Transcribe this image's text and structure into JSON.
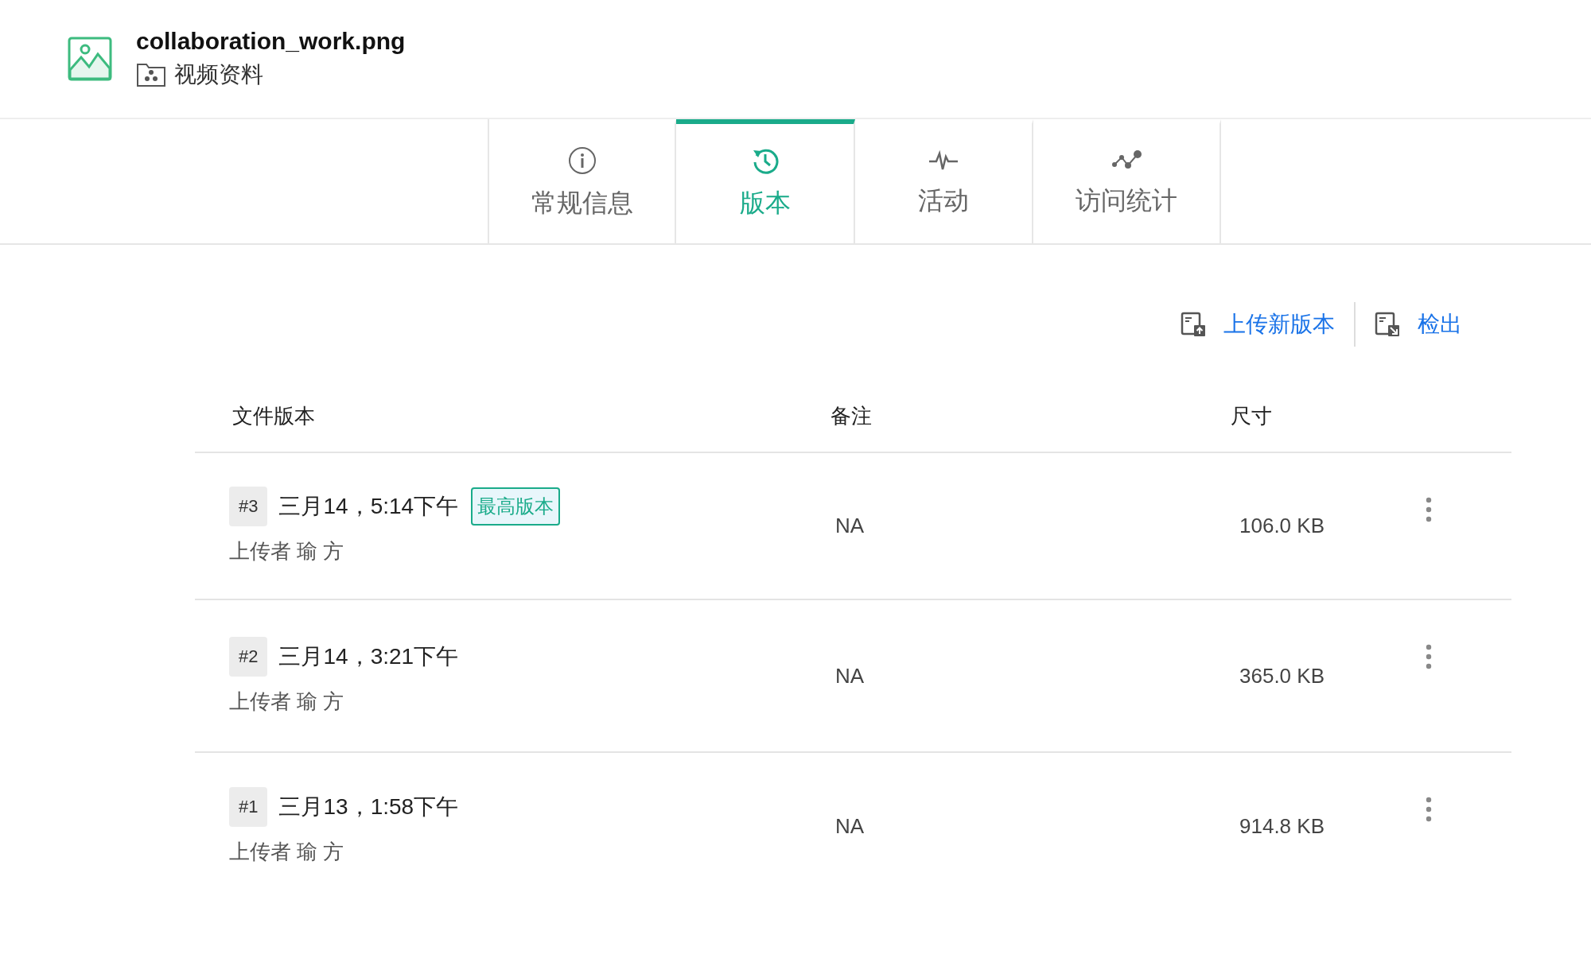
{
  "file": {
    "name": "collaboration_work.png",
    "folder": "视频资料"
  },
  "tabs": [
    {
      "label": "常规信息",
      "selected": false
    },
    {
      "label": "版本",
      "selected": true
    },
    {
      "label": "活动",
      "selected": false
    },
    {
      "label": "访问统计",
      "selected": false
    }
  ],
  "actions": [
    "上传新版本",
    "检出"
  ],
  "table": {
    "columns": [
      "文件版本",
      "备注",
      "尺寸"
    ],
    "rows": [
      {
        "number": "#3",
        "date": "三月14，5:14下午",
        "badge": "最高版本",
        "uploader": "上传者 瑜 方",
        "note": "NA",
        "size": "106.0 KB"
      },
      {
        "number": "#2",
        "date": "三月14，3:21下午",
        "uploader": "上传者 瑜 方",
        "note": "NA",
        "size": "365.0 KB"
      },
      {
        "number": "#1",
        "date": "三月13，1:58下午",
        "uploader": "上传者 瑜 方",
        "note": "NA",
        "size": "914.8 KB"
      }
    ]
  }
}
